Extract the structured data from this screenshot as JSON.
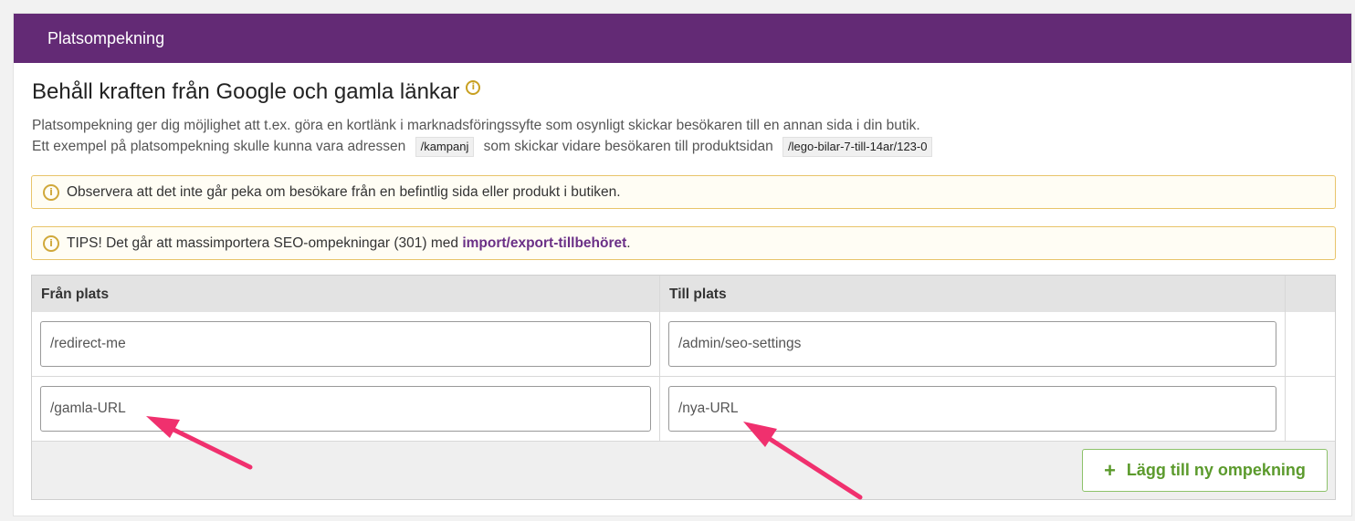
{
  "panel": {
    "header_title": "Platsompekning"
  },
  "content": {
    "title": "Behåll kraften från Google och gamla länkar",
    "desc_line1": "Platsompekning ger dig möjlighet att t.ex. göra en kortlänk i marknadsföringssyfte som osynligt skickar besökaren till en annan sida i din butik.",
    "desc_line2_a": "Ett exempel på platsompekning skulle kunna vara adressen",
    "desc_code1": "/kampanj",
    "desc_line2_b": "som skickar vidare besökaren till produktsidan",
    "desc_code2": "/lego-bilar-7-till-14ar/123-0"
  },
  "alerts": {
    "warning_text": "Observera att det inte går peka om besökare från en befintlig sida eller produkt i butiken.",
    "tip_text": "TIPS! Det går att massimportera SEO-ompekningar (301) med",
    "tip_link": "import/export-tillbehöret",
    "tip_end": "."
  },
  "table": {
    "columns": [
      "Från plats",
      "Till plats"
    ],
    "rows": [
      {
        "from": "/redirect-me",
        "to": "/admin/seo-settings"
      },
      {
        "from": "/gamla-URL",
        "to": "/nya-URL"
      }
    ],
    "add_button_label": "Lägg till ny ompekning",
    "add_button_icon": "plus-icon"
  },
  "colors": {
    "header_bg": "#632a75",
    "link": "#6a2f86",
    "button_green": "#5b9a2c",
    "alert_border": "#e8c46a",
    "arrow": "#f0306e"
  }
}
